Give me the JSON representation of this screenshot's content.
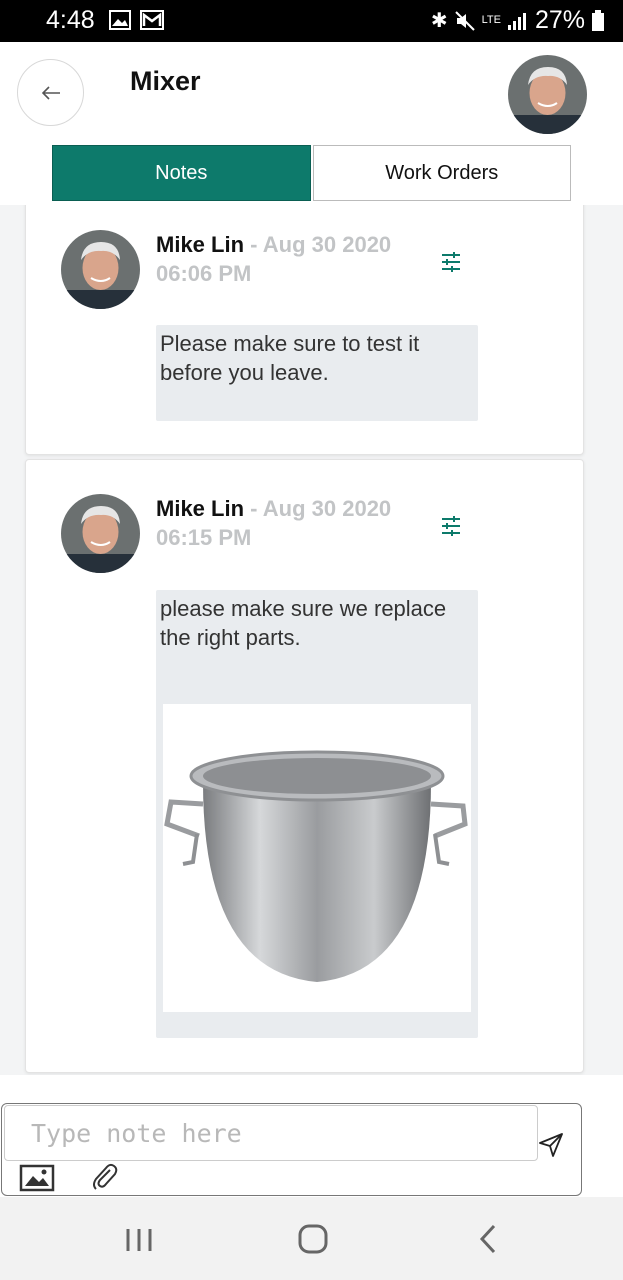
{
  "status_bar": {
    "time": "4:48",
    "lte": "LTE",
    "battery": "27%"
  },
  "header": {
    "title": "Mixer"
  },
  "tabs": [
    {
      "label": "Notes"
    },
    {
      "label": "Work Orders"
    }
  ],
  "notes": [
    {
      "author": "Mike Lin",
      "separator": "-",
      "date_line1": "Aug 30 2020",
      "date_line2": "06:06 PM",
      "text": "Please make sure to test it before you leave."
    },
    {
      "author": "Mike Lin",
      "separator": "-",
      "date_line1": "Aug 30 2020",
      "date_line2": "06:15 PM",
      "text": "please make sure we replace the right parts."
    }
  ],
  "composer": {
    "placeholder": "Type note here"
  },
  "colors": {
    "accent": "#0d7a6b"
  },
  "icons": [
    "back-arrow-icon",
    "filter-icon",
    "image-icon",
    "paperclip-icon",
    "send-icon",
    "recent-apps-icon",
    "home-icon",
    "back-nav-icon"
  ]
}
